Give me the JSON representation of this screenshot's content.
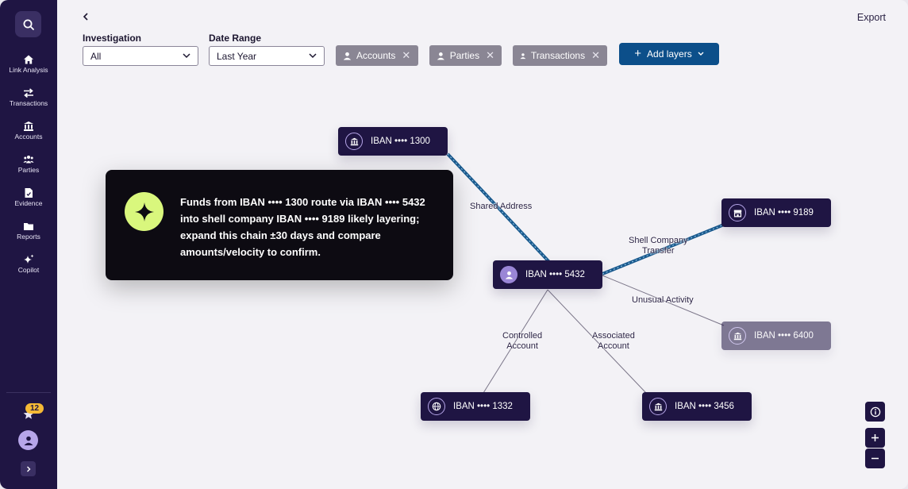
{
  "sidebar": {
    "items": [
      {
        "label": "Link Analysis",
        "icon": "home-icon"
      },
      {
        "label": "Transactions",
        "icon": "transfer-arrows-icon"
      },
      {
        "label": "Accounts",
        "icon": "bank-icon"
      },
      {
        "label": "Parties",
        "icon": "group-icon"
      },
      {
        "label": "Evidence",
        "icon": "document-icon"
      },
      {
        "label": "Reports",
        "icon": "folder-icon"
      },
      {
        "label": "Copilot",
        "icon": "sparkle-icon"
      }
    ],
    "notification_count": "12"
  },
  "header": {
    "export_label": "Export"
  },
  "filters": {
    "investigation_label": "Investigation",
    "investigation_value": "All",
    "date_range_label": "Date Range",
    "date_range_value": "Last Year",
    "chips": [
      "Accounts",
      "Parties",
      "Transactions"
    ],
    "add_layers_label": "Add layers"
  },
  "graph": {
    "nodes": {
      "n1300": "IBAN •••• 1300",
      "n5432": "IBAN •••• 5432",
      "n9189": "IBAN •••• 9189",
      "n6400": "IBAN •••• 6400",
      "n1332": "IBAN •••• 1332",
      "n3456": "IBAN •••• 3456"
    },
    "edges": {
      "shared_address": "Shared Address",
      "shell_company_1": "Shell Company",
      "shell_company_2": "Transfer",
      "unusual_activity": "Unusual Activity",
      "controlled_1": "Controlled",
      "controlled_2": "Account",
      "associated_1": "Associated",
      "associated_2": "Account"
    }
  },
  "copilot_insight": {
    "text": "Funds from IBAN •••• 1300 route via IBAN •••• 5432 into shell company IBAN •••• 9189 likely layering; expand this chain ±30 days and compare amounts/velocity to confirm."
  },
  "colors": {
    "sidebar": "#1f1543",
    "primary_button": "#0c4f8a",
    "highlight_edge": "#1a5a8e",
    "copilot_accent": "#d9f77d",
    "badge": "#f5b935"
  }
}
